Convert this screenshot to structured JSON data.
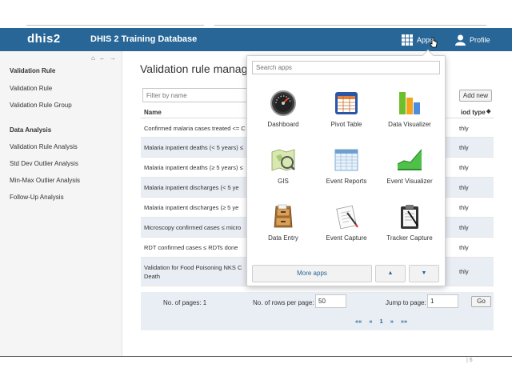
{
  "header": {
    "logo": "dhis2",
    "title": "DHIS 2 Training Database",
    "apps_label": "Apps",
    "profile_label": "Profile"
  },
  "sidebar": {
    "nav_icons": [
      "home-icon",
      "back-arrow-icon",
      "forward-arrow-icon"
    ],
    "sections": [
      {
        "heading": "Validation Rule",
        "items": [
          "Validation Rule",
          "Validation Rule Group"
        ]
      },
      {
        "heading": "Data Analysis",
        "items": [
          "Validation Rule Analysis",
          "Std Dev Outlier Analysis",
          "Min-Max Outlier Analysis",
          "Follow-Up Analysis"
        ]
      }
    ]
  },
  "main": {
    "title": "Validation rule managem",
    "filter_placeholder": "Filter by name",
    "add_new_label": "Add new",
    "columns": [
      "Name",
      "iod type"
    ],
    "rows": [
      {
        "name": "Confirmed malaria cases treated <= C",
        "type": "thly"
      },
      {
        "name": "Malaria inpatient deaths (< 5 years) ≤",
        "type": "thly"
      },
      {
        "name": "Malaria inpatient deaths (≥ 5 years) ≤",
        "type": "thly"
      },
      {
        "name": "Malaria inpatient discharges (< 5 ye",
        "type": "thly"
      },
      {
        "name": "Malaria inpatient discharges (≥ 5 ye",
        "type": "thly"
      },
      {
        "name": "Microscopy confirmed cases ≤ micro",
        "type": "thly"
      },
      {
        "name": "RDT confirmed cases ≤ RDTs done",
        "type": "thly"
      },
      {
        "name": "Validation for Food Poisoning NKS C",
        "name2": "Death",
        "type": "thly"
      }
    ],
    "pager": {
      "pages_label": "No. of pages: 1",
      "rows_label": "No. of rows per page:",
      "rows_value": "50",
      "jump_label": "Jump to page:",
      "jump_value": "1",
      "go_label": "Go",
      "links": [
        "««",
        "«",
        "1",
        "»",
        "»»"
      ]
    }
  },
  "apps_menu": {
    "search_placeholder": "Search apps",
    "apps": [
      {
        "label": "Dashboard",
        "icon": "dashboard-gauge-icon"
      },
      {
        "label": "Pivot Table",
        "icon": "pivot-table-icon"
      },
      {
        "label": "Data Visualizer",
        "icon": "bar-chart-icon"
      },
      {
        "label": "GIS",
        "icon": "gis-map-icon"
      },
      {
        "label": "Event Reports",
        "icon": "event-reports-table-icon"
      },
      {
        "label": "Event Visualizer",
        "icon": "area-chart-icon"
      },
      {
        "label": "Data Entry",
        "icon": "filing-cabinet-icon"
      },
      {
        "label": "Event Capture",
        "icon": "notepad-pen-icon"
      },
      {
        "label": "Tracker Capture",
        "icon": "clipboard-pen-icon"
      }
    ],
    "more_apps_label": "More apps",
    "up_symbol": "▲",
    "down_symbol": "▼"
  },
  "footer": {
    "slide_number": "| 6"
  },
  "colors": {
    "header_bg": "#276696",
    "row_alt_bg": "#e9eef4",
    "sidebar_bg": "#f5f5f5"
  }
}
